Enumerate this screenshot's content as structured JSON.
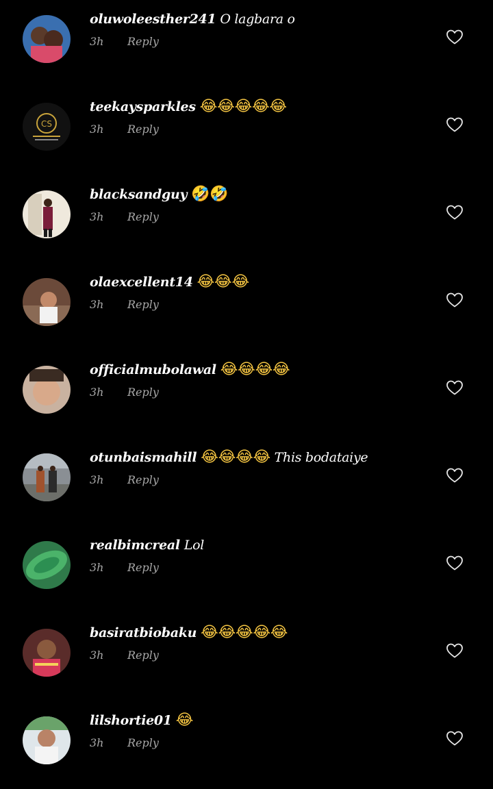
{
  "comments": [
    {
      "username": "oluwoleesther241",
      "text": "O lagbara o",
      "time": "3h",
      "reply_label": "Reply"
    },
    {
      "username": "teekaysparkles",
      "text": "😂😂😂😂😂",
      "time": "3h",
      "reply_label": "Reply"
    },
    {
      "username": "blacksandguy",
      "text": "🤣🤣",
      "time": "3h",
      "reply_label": "Reply"
    },
    {
      "username": "olaexcellent14",
      "text": "😂😂😂",
      "time": "3h",
      "reply_label": "Reply"
    },
    {
      "username": "officialmubolawal",
      "text": "😂😂😂😂",
      "time": "3h",
      "reply_label": "Reply"
    },
    {
      "username": "otunbaismahill",
      "text": "😂😂😂😂 This bodataiye",
      "time": "3h",
      "reply_label": "Reply"
    },
    {
      "username": "realbimcreal",
      "text": "Lol",
      "time": "3h",
      "reply_label": "Reply"
    },
    {
      "username": "basiratbiobaku",
      "text": "😂😂😂😂😂",
      "time": "3h",
      "reply_label": "Reply"
    },
    {
      "username": "lilshortie01",
      "text": "😂",
      "time": "3h",
      "reply_label": "Reply"
    }
  ],
  "colors": {
    "background": "#000000",
    "username": "#ffffff",
    "meta": "#a8a8a8",
    "emoji": "#f5c542",
    "like_icon": "#e6e6e6"
  },
  "icons": {
    "like": "heart-outline-icon"
  }
}
